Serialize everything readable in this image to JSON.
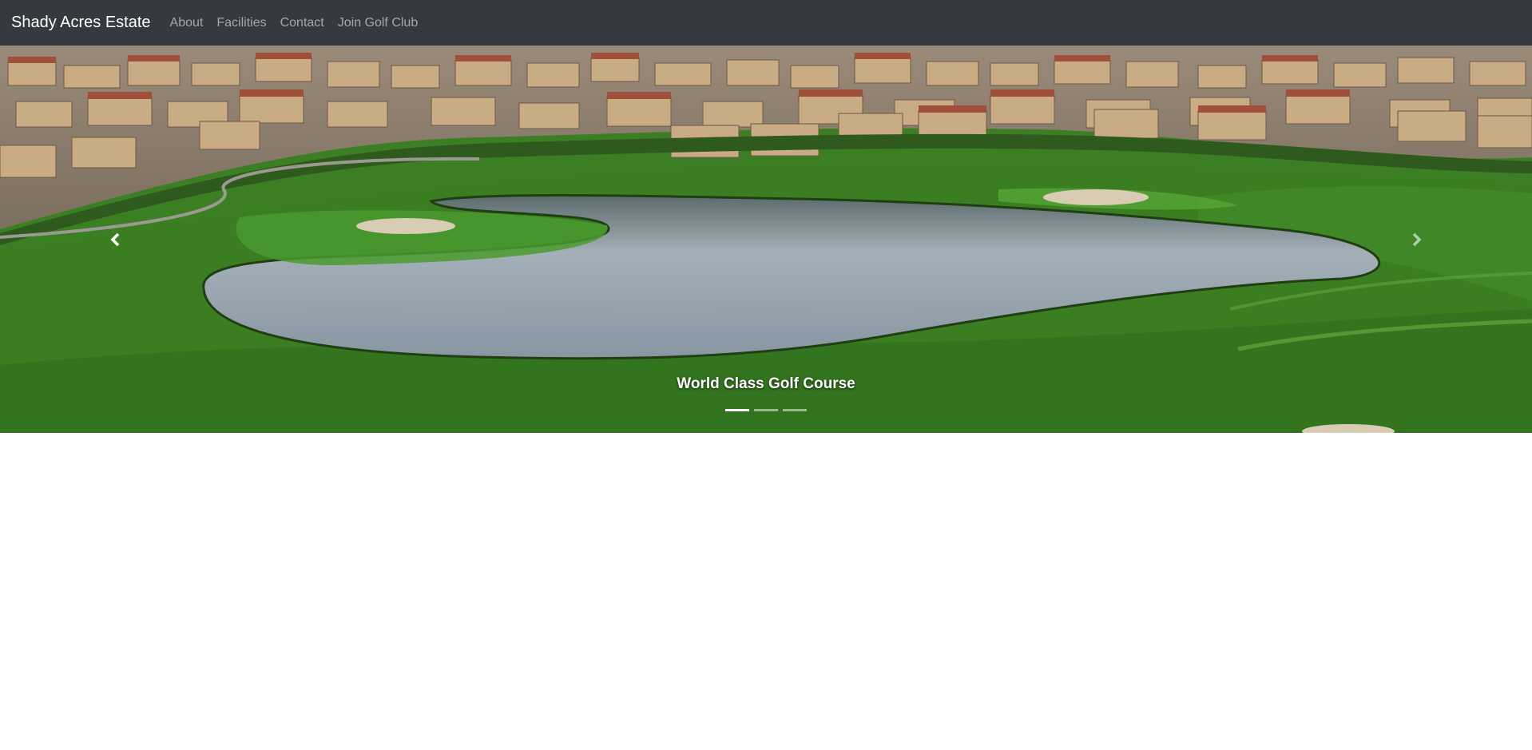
{
  "navbar": {
    "brand": "Shady Acres Estate",
    "links": [
      "About",
      "Facilities",
      "Contact",
      "Join Golf Club"
    ],
    "background": "#343a40"
  },
  "carousel": {
    "caption": "World Class Golf Course",
    "slide_count": 3,
    "active_slide": 1,
    "prev_icon": "chevron-left-icon",
    "next_icon": "chevron-right-icon"
  }
}
